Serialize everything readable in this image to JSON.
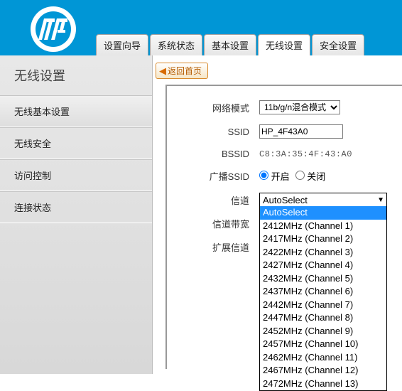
{
  "tabs": {
    "t0": "设置向导",
    "t1": "系统状态",
    "t2": "基本设置",
    "t3": "无线设置",
    "t4": "安全设置"
  },
  "sidebar": {
    "title": "无线设置",
    "it0": "无线基本设置",
    "it1": "无线安全",
    "it2": "访问控制",
    "it3": "连接状态"
  },
  "back": {
    "label": "返回首页"
  },
  "form": {
    "network_mode_label": "网络模式",
    "network_mode_value": "11b/g/n混合模式",
    "ssid_label": "SSID",
    "ssid_value": "HP_4F43A0",
    "bssid_label": "BSSID",
    "bssid_value": "C8:3A:35:4F:43:A0",
    "broadcast_label": "广播SSID",
    "broadcast_on": "开启",
    "broadcast_off": "关闭",
    "channel_label": "信道",
    "channel_value": "AutoSelect",
    "bandwidth_label": "信道带宽",
    "ext_channel_label": "扩展信道"
  },
  "channel_options": {
    "o0": "AutoSelect",
    "o1": "2412MHz (Channel 1)",
    "o2": "2417MHz (Channel 2)",
    "o3": "2422MHz (Channel 3)",
    "o4": "2427MHz (Channel 4)",
    "o5": "2432MHz (Channel 5)",
    "o6": "2437MHz (Channel 6)",
    "o7": "2442MHz (Channel 7)",
    "o8": "2447MHz (Channel 8)",
    "o9": "2452MHz (Channel 9)",
    "o10": "2457MHz (Channel 10)",
    "o11": "2462MHz (Channel 11)",
    "o12": "2467MHz (Channel 12)",
    "o13": "2472MHz (Channel 13)"
  }
}
